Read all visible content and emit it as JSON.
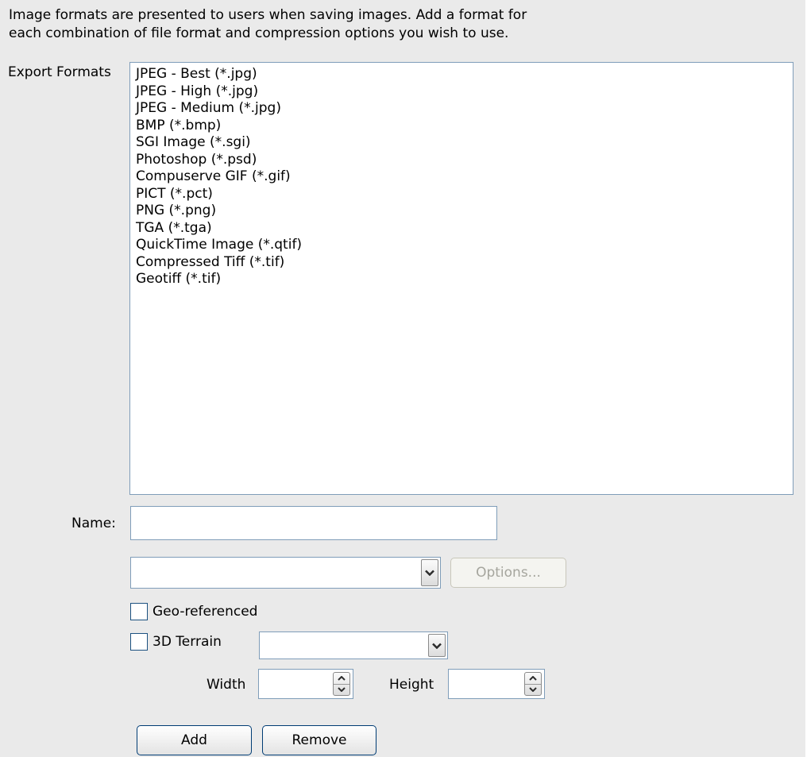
{
  "intro": {
    "line1": "Image formats are presented to users when saving images. Add a format for",
    "line2": "each combination of file format and compression options you wish to use."
  },
  "export_formats_label": "Export Formats",
  "formats": [
    "JPEG - Best (*.jpg)",
    "JPEG - High (*.jpg)",
    "JPEG - Medium (*.jpg)",
    "BMP (*.bmp)",
    "SGI Image (*.sgi)",
    "Photoshop (*.psd)",
    "Compuserve GIF (*.gif)",
    "PICT (*.pct)",
    "PNG (*.png)",
    "TGA (*.tga)",
    "QuickTime Image (*.qtif)",
    "Compressed Tiff (*.tif)",
    "Geotiff (*.tif)"
  ],
  "name": {
    "label": "Name:",
    "value": ""
  },
  "format_select": {
    "value": "",
    "icon": "chevron-down-icon"
  },
  "options_button": "Options...",
  "geo_referenced": {
    "label": "Geo-referenced",
    "checked": false
  },
  "terrain": {
    "label": "3D Terrain",
    "checked": false,
    "select_value": ""
  },
  "width": {
    "label": "Width",
    "value": ""
  },
  "height": {
    "label": "Height",
    "value": ""
  },
  "add_button": "Add",
  "remove_button": "Remove",
  "colors": {
    "panel_bg": "#eaeaea",
    "field_border": "#7f9db9",
    "button_border": "#003c74",
    "disabled_text": "#a5a59d"
  }
}
